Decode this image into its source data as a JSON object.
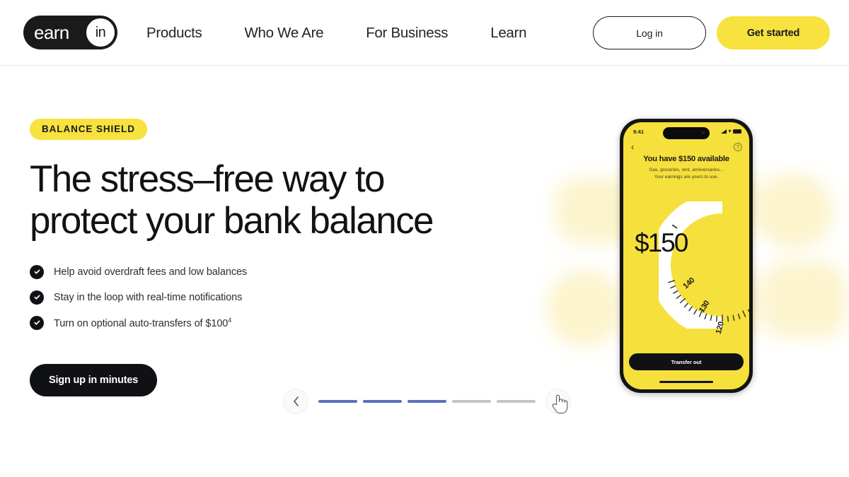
{
  "header": {
    "logo": {
      "word1": "earn",
      "word2": "in",
      "name": "earnin-logo"
    },
    "nav": [
      {
        "label": "Products"
      },
      {
        "label": "Who We Are"
      },
      {
        "label": "For Business"
      },
      {
        "label": "Learn"
      }
    ],
    "login_label": "Log in",
    "getstarted_label": "Get started"
  },
  "hero": {
    "eyebrow": "BALANCE SHIELD",
    "headline_line1": "The stress–free way to",
    "headline_line2": "protect your bank balance",
    "bullets": [
      {
        "text": "Help avoid overdraft fees and low balances",
        "sup": ""
      },
      {
        "text": "Stay in the loop with real-time notifications",
        "sup": ""
      },
      {
        "text": "Turn on optional auto-transfers of $100",
        "sup": "4"
      }
    ],
    "cta_label": "Sign up in minutes"
  },
  "phone": {
    "status_time": "9:41",
    "title": "You have $150 available",
    "subtitle_line1": "Gas, groceries, rent, anniversaries...",
    "subtitle_line2": "Your earnings are yours to use.",
    "amount": "$150",
    "dial_ticks": [
      "140",
      "130",
      "120"
    ],
    "transfer_label": "Transfer out",
    "help_glyph": "?",
    "back_glyph": "‹"
  },
  "carousel": {
    "prev_label": "‹",
    "next_label": "›",
    "slides": [
      {
        "state": "on"
      },
      {
        "state": "on"
      },
      {
        "state": "on"
      },
      {
        "state": "off"
      },
      {
        "state": "off"
      }
    ]
  },
  "colors": {
    "brand_yellow": "#f7e23f",
    "screen_yellow": "#f5e03c",
    "ink": "#101114",
    "carousel_active": "#5b6fbe",
    "carousel_inactive": "#c4c4c4",
    "blob": "#fbf2c4"
  }
}
